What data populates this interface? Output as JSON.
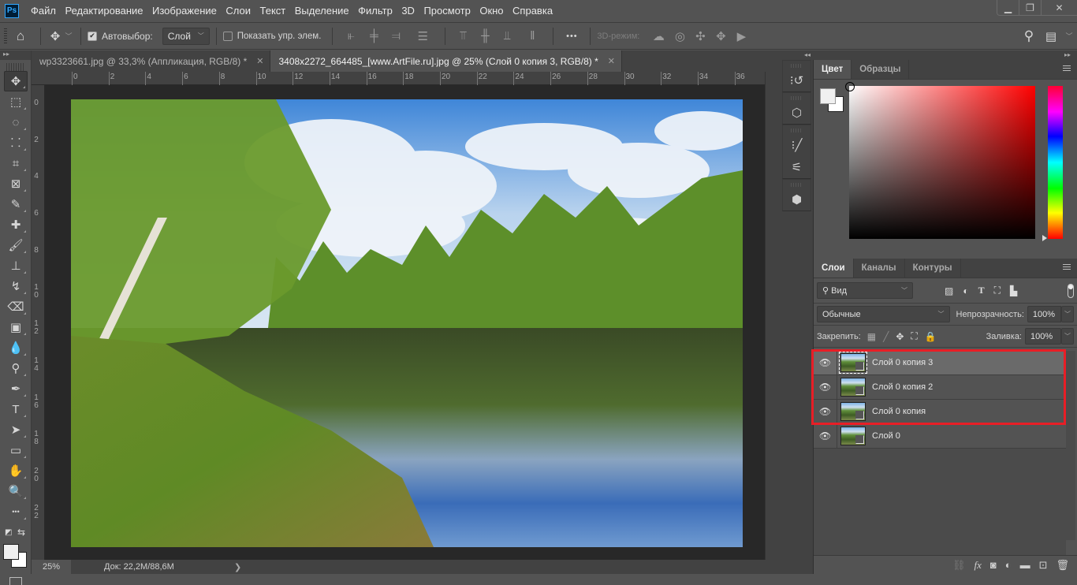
{
  "app": {
    "logo": "Ps"
  },
  "menu": [
    "Файл",
    "Редактирование",
    "Изображение",
    "Слои",
    "Текст",
    "Выделение",
    "Фильтр",
    "3D",
    "Просмотр",
    "Окно",
    "Справка"
  ],
  "window_controls": {
    "minimize": "▁",
    "restore": "❐",
    "close": "✕"
  },
  "options_bar": {
    "autoselect_label": "Автовыбор:",
    "autoselect_checked": true,
    "autoselect_target": "Слой",
    "show_transform_label": "Показать упр. элем.",
    "show_transform_checked": false,
    "mode_3d_label": "3D-режим:"
  },
  "tabs": [
    {
      "title": "wp3323661.jpg @ 33,3% (Аппликация, RGB/8) *",
      "active": false
    },
    {
      "title": "3408x2272_664485_[www.ArtFile.ru].jpg @ 25% (Слой 0 копия 3, RGB/8) *",
      "active": true
    }
  ],
  "rulers": {
    "top": [
      "0",
      "2",
      "4",
      "6",
      "8",
      "10",
      "12",
      "14",
      "16",
      "18",
      "20",
      "22",
      "24",
      "26",
      "28",
      "30",
      "32",
      "34",
      "36"
    ],
    "left": [
      "0",
      "2",
      "4",
      "6",
      "8",
      "1 0",
      "1 2",
      "1 4",
      "1 6",
      "1 8",
      "2 0",
      "2 2"
    ]
  },
  "tools": [
    {
      "name": "move-tool",
      "glyph": "✥",
      "active": true
    },
    {
      "name": "marquee-tool",
      "glyph": "⬚"
    },
    {
      "name": "lasso-tool",
      "glyph": "◌"
    },
    {
      "name": "quick-selection-tool",
      "glyph": "⸬"
    },
    {
      "name": "crop-tool",
      "glyph": "⌗"
    },
    {
      "name": "frame-tool",
      "glyph": "⊠"
    },
    {
      "name": "eyedropper-tool",
      "glyph": "✎"
    },
    {
      "name": "healing-brush-tool",
      "glyph": "✚"
    },
    {
      "name": "brush-tool",
      "glyph": "🖌"
    },
    {
      "name": "clone-stamp-tool",
      "glyph": "⊥"
    },
    {
      "name": "history-brush-tool",
      "glyph": "↯"
    },
    {
      "name": "eraser-tool",
      "glyph": "⌫"
    },
    {
      "name": "gradient-tool",
      "glyph": "▣"
    },
    {
      "name": "blur-tool",
      "glyph": "💧"
    },
    {
      "name": "dodge-tool",
      "glyph": "⚲"
    },
    {
      "name": "pen-tool",
      "glyph": "✒"
    },
    {
      "name": "type-tool",
      "glyph": "T"
    },
    {
      "name": "path-selection-tool",
      "glyph": "➤"
    },
    {
      "name": "rectangle-tool",
      "glyph": "▭"
    },
    {
      "name": "hand-tool",
      "glyph": "✋"
    },
    {
      "name": "zoom-tool",
      "glyph": "🔍"
    },
    {
      "name": "more-tools",
      "glyph": "•••"
    }
  ],
  "status": {
    "zoom": "25%",
    "doc": "Док: 22,2M/88,6M",
    "arrow": "❯"
  },
  "color_panel": {
    "tabs": [
      "Цвет",
      "Образцы"
    ],
    "foreground": "#f0f0f0",
    "background": "#ffffff",
    "hue": "#ff0000"
  },
  "layers_panel": {
    "tabs": [
      "Слои",
      "Каналы",
      "Контуры"
    ],
    "filter_label": "Вид",
    "blend_mode": "Обычные",
    "opacity_label": "Непрозрачность:",
    "opacity_value": "100%",
    "lock_label": "Закрепить:",
    "fill_label": "Заливка:",
    "fill_value": "100%",
    "layers": [
      {
        "name": "Слой 0 копия 3",
        "visible": true,
        "selected": true
      },
      {
        "name": "Слой 0 копия 2",
        "visible": true,
        "selected": false
      },
      {
        "name": "Слой 0 копия",
        "visible": true,
        "selected": false
      },
      {
        "name": "Слой 0",
        "visible": true,
        "selected": false
      }
    ],
    "highlight_color": "#e81e26"
  }
}
